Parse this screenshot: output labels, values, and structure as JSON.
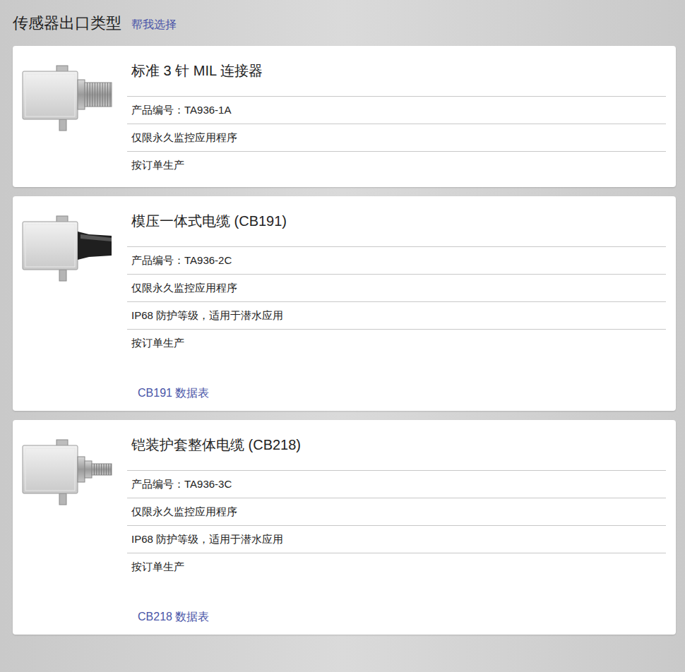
{
  "header": {
    "title": "传感器出口类型",
    "help_link": "帮我选择"
  },
  "options": [
    {
      "kind": "connector",
      "title": "标准 3 针 MIL 连接器",
      "details": [
        "产品编号：TA936-1A",
        "仅限永久监控应用程序",
        "按订单生产"
      ]
    },
    {
      "kind": "molded-cable",
      "title": "模压一体式电缆 (CB191)",
      "details": [
        "产品编号：TA936-2C",
        "仅限永久监控应用程序",
        "IP68 防护等级，适用于潜水应用",
        "按订单生产"
      ],
      "datasheet": "CB191 数据表"
    },
    {
      "kind": "armored-cable",
      "title": "铠装护套整体电缆 (CB218)",
      "details": [
        "产品编号：TA936-3C",
        "仅限永久监控应用程序",
        "IP68 防护等级，适用于潜水应用",
        "按订单生产"
      ],
      "datasheet": "CB218 数据表"
    }
  ]
}
